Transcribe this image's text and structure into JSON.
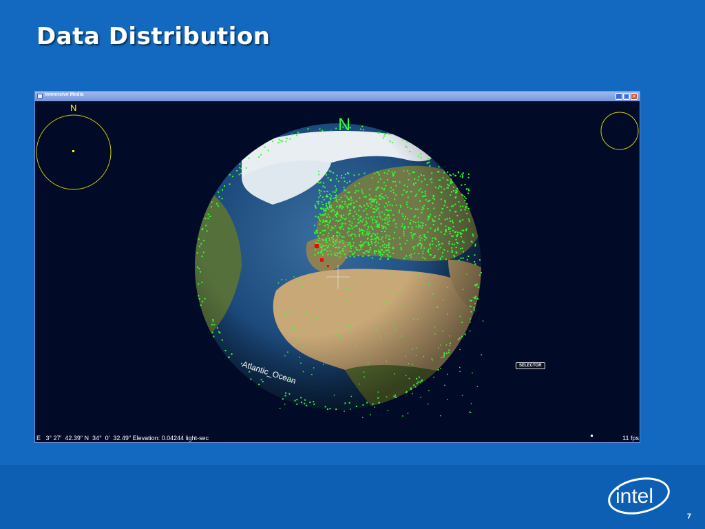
{
  "slide": {
    "title": "Data Distribution",
    "page_number": "7",
    "logo_text": "intel"
  },
  "window": {
    "title": "Immersive Media",
    "buttons": {
      "minimize": "_",
      "maximize": "□",
      "close": "×"
    }
  },
  "globe": {
    "north_label_small": "N",
    "north_label_large": "N",
    "ocean_label": "Atlantic_Ocean",
    "selector_label": "SELECTOR"
  },
  "status": {
    "coordinates": "E   3° 27'  42.39\" N  34°  0'  32.49\" Elevation: 0.04244 light-sec",
    "fps": "11 fps"
  },
  "colors": {
    "background": "#1369bf",
    "data_points": "#33ff33",
    "highlight_points": "#ff0000",
    "compass": "#d8d000"
  }
}
